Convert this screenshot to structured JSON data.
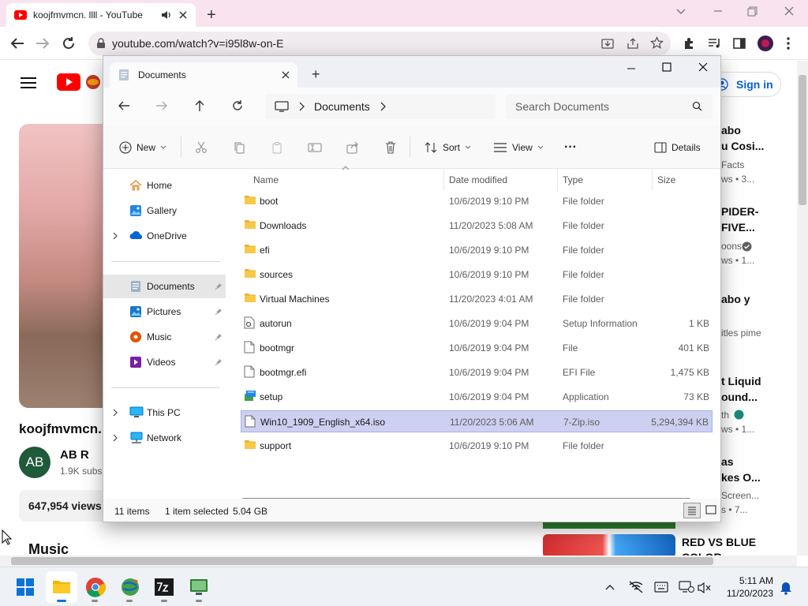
{
  "browser": {
    "tab_title": "koojfmvmcn. llll - YouTube",
    "new_tab_label": "+",
    "url": "youtube.com/watch?v=i95l8w-on-E"
  },
  "youtube": {
    "sign_in": "Sign in",
    "video_title_partial": "koojfmvmcn.",
    "channel_avatar": "AB",
    "channel_name": "AB R",
    "subscribers_partial": "1.9K subs",
    "views": "647,954 views",
    "section_heading": "Music",
    "sidebar": [
      {
        "title": "abo",
        "title2": "u Cosi...",
        "meta1": "Facts",
        "meta2": "ws • 3..."
      },
      {
        "title": "PIDER-",
        "title2": "FIVE...",
        "meta1": "oons",
        "meta2": "ws • 1..."
      },
      {
        "title": "abo y",
        "title2": "",
        "meta1": "itles pime",
        "meta2": ""
      },
      {
        "title": "t Liquid",
        "title2": "ound...",
        "meta1": "th",
        "meta2": "ws • 1..."
      },
      {
        "title": "as",
        "title2": "kes O...",
        "meta1": "Screen...",
        "meta2": "s • 7..."
      },
      {
        "title": "RED VS BLUE",
        "title2": "COLOR",
        "meta1": "",
        "meta2": ""
      }
    ]
  },
  "explorer": {
    "tab_title": "Documents",
    "new_tab": "+",
    "address_segment": "Documents",
    "search_placeholder": "Search Documents",
    "toolbar": {
      "new": "New",
      "sort": "Sort",
      "view": "View",
      "more": "···",
      "details": "Details"
    },
    "nav": {
      "home": "Home",
      "gallery": "Gallery",
      "onedrive": "OneDrive",
      "documents": "Documents",
      "pictures": "Pictures",
      "music": "Music",
      "videos": "Videos",
      "this_pc": "This PC",
      "network": "Network"
    },
    "columns": {
      "name": "Name",
      "date": "Date modified",
      "type": "Type",
      "size": "Size"
    },
    "files": [
      {
        "name": "boot",
        "date": "10/6/2019 9:10 PM",
        "type": "File folder",
        "size": "",
        "icon": "folder-icon"
      },
      {
        "name": "Downloads",
        "date": "11/20/2023 5:08 AM",
        "type": "File folder",
        "size": "",
        "icon": "folder-icon"
      },
      {
        "name": "efi",
        "date": "10/6/2019 9:10 PM",
        "type": "File folder",
        "size": "",
        "icon": "folder-icon"
      },
      {
        "name": "sources",
        "date": "10/6/2019 9:10 PM",
        "type": "File folder",
        "size": "",
        "icon": "folder-icon"
      },
      {
        "name": "Virtual Machines",
        "date": "11/20/2023 4:01 AM",
        "type": "File folder",
        "size": "",
        "icon": "folder-icon"
      },
      {
        "name": "autorun",
        "date": "10/6/2019 9:04 PM",
        "type": "Setup Information",
        "size": "1 KB",
        "icon": "settings-file-icon"
      },
      {
        "name": "bootmgr",
        "date": "10/6/2019 9:04 PM",
        "type": "File",
        "size": "401 KB",
        "icon": "file-icon"
      },
      {
        "name": "bootmgr.efi",
        "date": "10/6/2019 9:04 PM",
        "type": "EFI File",
        "size": "1,475 KB",
        "icon": "file-icon"
      },
      {
        "name": "setup",
        "date": "10/6/2019 9:04 PM",
        "type": "Application",
        "size": "73 KB",
        "icon": "setup-app-icon"
      },
      {
        "name": "Win10_1909_English_x64.iso",
        "date": "11/20/2023 5:06 AM",
        "type": "7-Zip.iso",
        "size": "5,294,394 KB",
        "icon": "file-icon"
      },
      {
        "name": "support",
        "date": "10/6/2019 9:10 PM",
        "type": "File folder",
        "size": "",
        "icon": "folder-icon"
      }
    ],
    "status": {
      "items": "11 items",
      "selected": "1 item selected",
      "size": "5.04 GB"
    }
  },
  "taskbar": {
    "time": "5:11 AM",
    "date": "11/20/2023"
  },
  "colors": {
    "chrome_tabbar": "#f8e3ef",
    "youtube_red": "#ff0000",
    "selection": "#cdd0f0",
    "folder": "#f7c948",
    "sign_in_blue": "#065fd4"
  }
}
